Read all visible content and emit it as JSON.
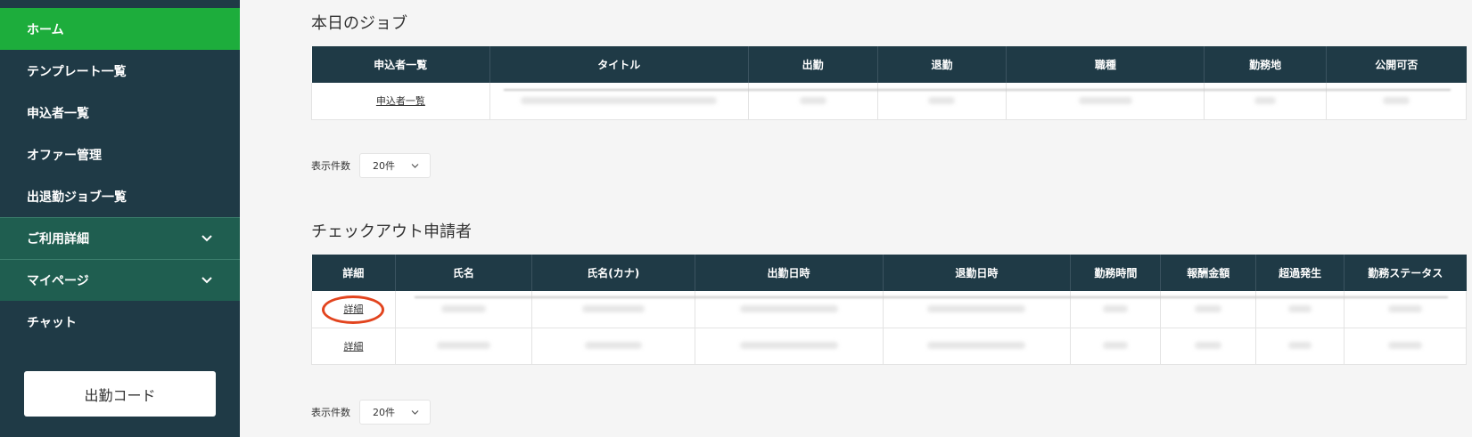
{
  "sidebar": {
    "items": [
      {
        "label": "ホーム"
      },
      {
        "label": "テンプレート一覧"
      },
      {
        "label": "申込者一覧"
      },
      {
        "label": "オファー管理"
      },
      {
        "label": "出退勤ジョブ一覧"
      },
      {
        "label": "ご利用詳細"
      },
      {
        "label": "マイページ"
      },
      {
        "label": "チャット"
      }
    ],
    "code_button": "出勤コード"
  },
  "jobs": {
    "title": "本日のジョブ",
    "headers": [
      "申込者一覧",
      "タイトル",
      "出勤",
      "退勤",
      "職種",
      "勤務地",
      "公開可否"
    ],
    "row_link": "申込者一覧",
    "pager_label": "表示件数",
    "pager_value": "20件"
  },
  "checkout": {
    "title": "チェックアウト申請者",
    "headers": [
      "詳細",
      "氏名",
      "氏名(カナ)",
      "出勤日時",
      "退勤日時",
      "勤務時間",
      "報酬金額",
      "超過発生",
      "勤務ステータス"
    ],
    "row_links": [
      "詳細",
      "詳細"
    ],
    "pager_label": "表示件数",
    "pager_value": "20件"
  },
  "colors": {
    "sidebar": "#1f3a46",
    "active": "#1dad3c",
    "accordion": "#1f5e50",
    "highlight": "#e2441e"
  }
}
